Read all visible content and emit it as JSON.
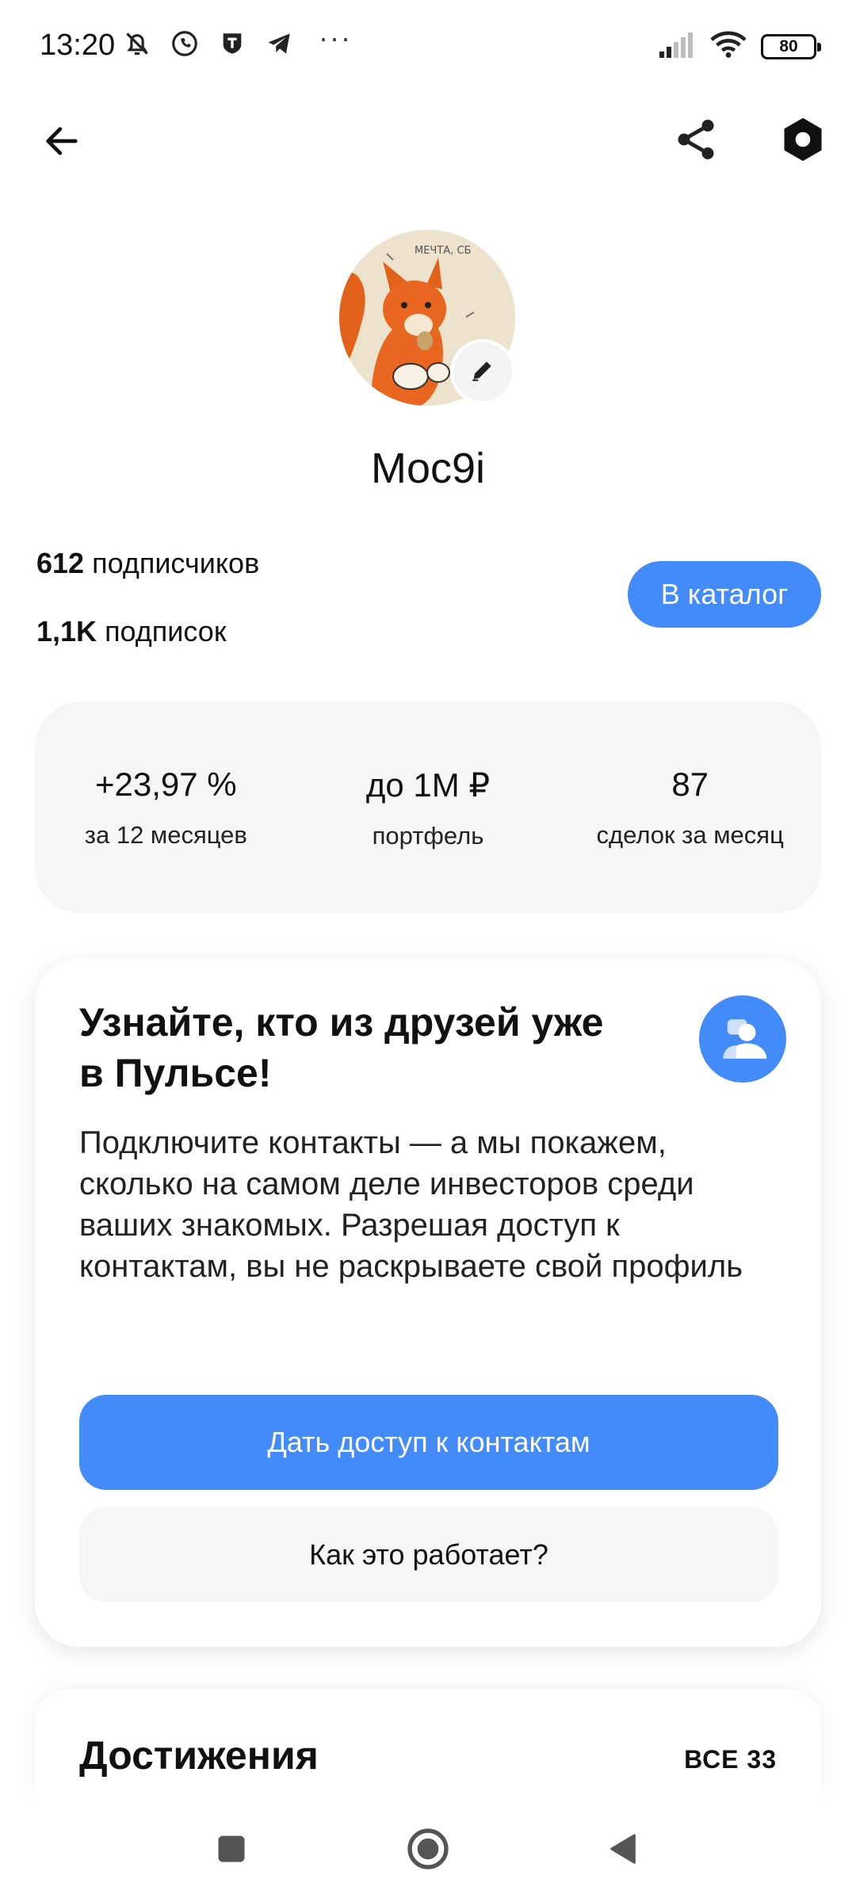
{
  "status_bar": {
    "time": "13:20",
    "battery": "80",
    "more": "···",
    "icons_left": [
      "silent-bell-icon",
      "whatsapp-icon",
      "shield-app-icon",
      "telegram-icon"
    ],
    "icons_right": [
      "signal-icon",
      "wifi-icon",
      "battery-icon"
    ]
  },
  "top_bar": {
    "icons": [
      "back-arrow-icon",
      "share-icon",
      "settings-hex-icon"
    ]
  },
  "profile": {
    "username": "Moc9i",
    "followers_count": "612",
    "followers_label": "подписчиков",
    "following_count": "1,1K",
    "following_label": "подписок",
    "catalog_button": "В каталог"
  },
  "metrics": [
    {
      "value": "+23,97 %",
      "label": "за 12 месяцев"
    },
    {
      "value": "до 1М ₽",
      "label": "портфель"
    },
    {
      "value": "87",
      "label": "сделок за месяц"
    }
  ],
  "contacts_card": {
    "title": "Узнайте, кто из друзей уже в Пульсе!",
    "description": "Подключите контакты — а мы покажем, сколько на самом деле инвесторов среди ваших знакомых. Разрешая доступ к контактам, вы не раскрываете свой профиль",
    "primary_button": "Дать доступ к контактам",
    "secondary_button": "Как это работает?"
  },
  "achievements": {
    "title": "Достижения",
    "all_label": "ВСЕ 33"
  },
  "colors": {
    "accent": "#428bf9",
    "card_bg": "#f5f6f6",
    "text": "#111111"
  }
}
